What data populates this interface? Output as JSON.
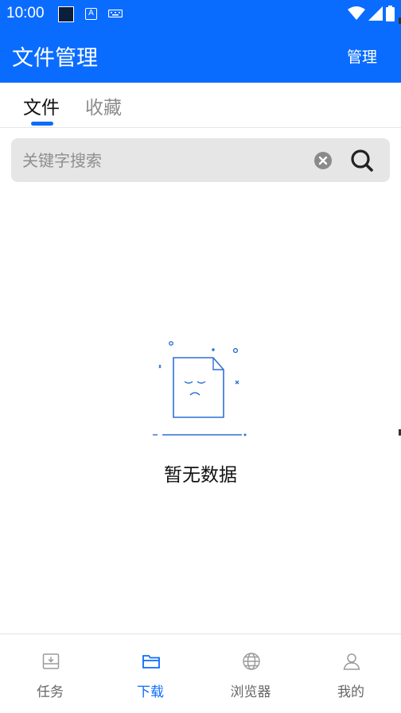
{
  "status_bar": {
    "time": "10:00",
    "a_icon_text": "A"
  },
  "app_bar": {
    "title": "文件管理",
    "action_label": "管理"
  },
  "tabs": [
    {
      "label": "文件",
      "active": true
    },
    {
      "label": "收藏",
      "active": false
    }
  ],
  "search": {
    "placeholder": "关键字搜索",
    "value": ""
  },
  "empty_state": {
    "message": "暂无数据"
  },
  "bottom_nav": [
    {
      "label": "任务",
      "icon": "download-tray-icon",
      "active": false
    },
    {
      "label": "下载",
      "icon": "folder-icon",
      "active": true
    },
    {
      "label": "浏览器",
      "icon": "globe-icon",
      "active": false
    },
    {
      "label": "我的",
      "icon": "user-icon",
      "active": false
    }
  ],
  "colors": {
    "primary": "#0a6cff",
    "inactive_text": "#8c8c8c",
    "search_bg": "#e6e6e6"
  }
}
